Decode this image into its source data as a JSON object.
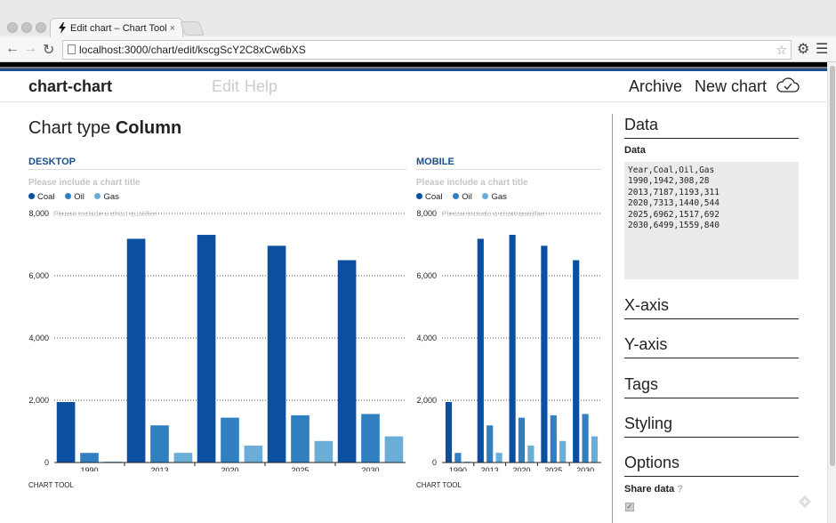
{
  "browser": {
    "tab_title": "Edit chart – Chart Tool",
    "tab_close": "×",
    "url": "localhost:3000/chart/edit/kscgScY2C8xCw6bXS"
  },
  "nav": {
    "brand": "chart-chart",
    "edit": "Edit",
    "help": "Help",
    "archive": "Archive",
    "new_chart": "New chart"
  },
  "editor": {
    "chart_type_label": "Chart type",
    "chart_type_value": "Column"
  },
  "desktop": {
    "heading": "DESKTOP",
    "title_placeholder": "Please include a chart title",
    "qualifier": "Please include a chart qualifier",
    "credit": "CHART TOOL"
  },
  "mobile": {
    "heading": "MOBILE",
    "title_placeholder": "Please include a chart title",
    "qualifier": "Please include a chart qualifier",
    "credit": "CHART TOOL"
  },
  "sidebar": {
    "data_heading": "Data",
    "data_label": "Data",
    "data_csv": "Year,Coal,Oil,Gas\n1990,1942,308,28\n2013,7187,1193,311\n2020,7313,1440,544\n2025,6962,1517,692\n2030,6499,1559,840",
    "xaxis": "X-axis",
    "yaxis": "Y-axis",
    "tags": "Tags",
    "styling": "Styling",
    "options": "Options",
    "share_data": "Share data",
    "share_help": "?"
  },
  "colors": {
    "coal": "#0a4fa0",
    "oil": "#2f7fc1",
    "gas": "#6aaed8"
  },
  "chart_data": [
    {
      "type": "bar",
      "title": "",
      "categories": [
        "1990",
        "2013",
        "2020",
        "2025",
        "2030"
      ],
      "series": [
        {
          "name": "Coal",
          "values": [
            1942,
            7187,
            7313,
            6962,
            6499
          ]
        },
        {
          "name": "Oil",
          "values": [
            308,
            1193,
            1440,
            1517,
            1559
          ]
        },
        {
          "name": "Gas",
          "values": [
            28,
            311,
            544,
            692,
            840
          ]
        }
      ],
      "yticks": [
        "0",
        "2,000",
        "4,000",
        "6,000",
        "8,000"
      ],
      "ylim": [
        0,
        8000
      ],
      "grid": true,
      "legend": "top-left"
    },
    {
      "type": "bar",
      "title": "",
      "categories": [
        "1990",
        "2013",
        "2020",
        "2025",
        "2030"
      ],
      "series": [
        {
          "name": "Coal",
          "values": [
            1942,
            7187,
            7313,
            6962,
            6499
          ]
        },
        {
          "name": "Oil",
          "values": [
            308,
            1193,
            1440,
            1517,
            1559
          ]
        },
        {
          "name": "Gas",
          "values": [
            28,
            311,
            544,
            692,
            840
          ]
        }
      ],
      "yticks": [
        "0",
        "2,000",
        "4,000",
        "6,000",
        "8,000"
      ],
      "ylim": [
        0,
        8000
      ],
      "grid": true,
      "legend": "top-left"
    }
  ]
}
